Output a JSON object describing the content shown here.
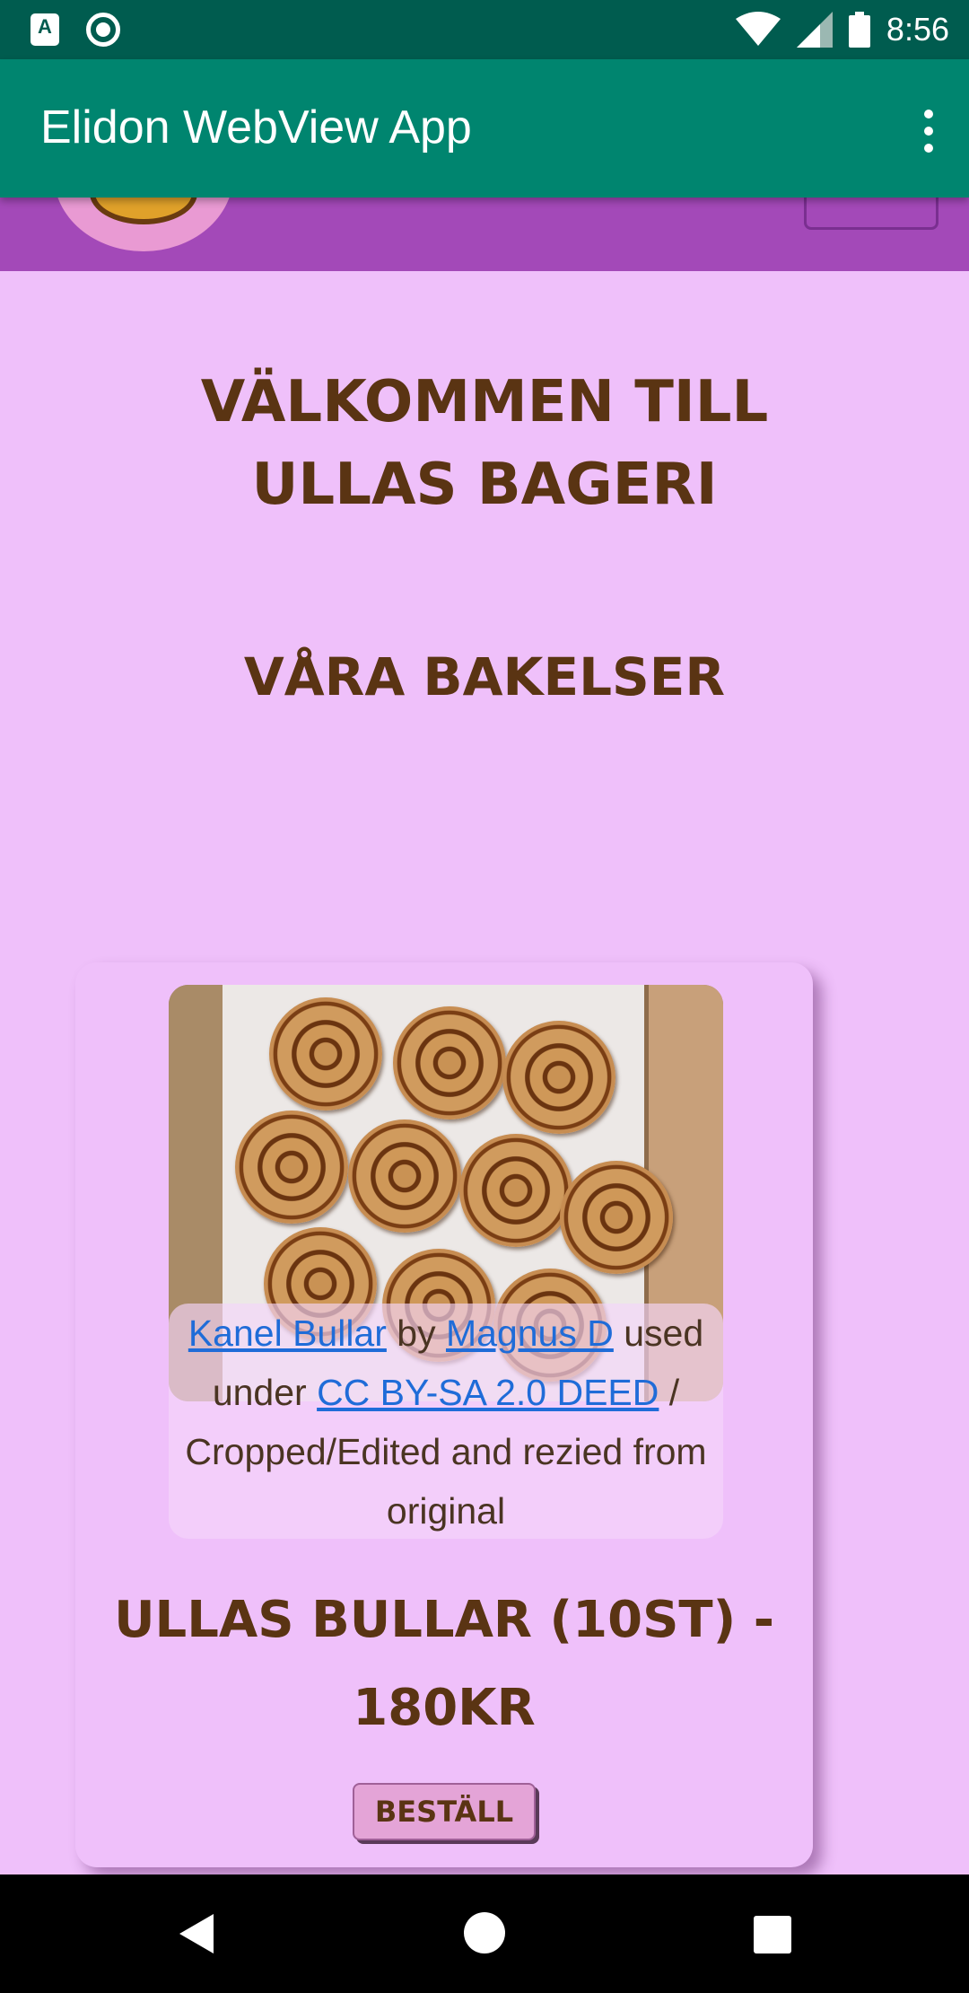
{
  "status_bar": {
    "time": "8:56",
    "icons": [
      "app-notification-icon",
      "circle-notification-icon",
      "wifi-icon",
      "cell-signal-icon",
      "battery-icon"
    ]
  },
  "app_bar": {
    "title": "Elidon WebView App",
    "menu_icon": "overflow-menu-icon"
  },
  "page": {
    "welcome_heading": "Välkommen till Ullas Bageri",
    "section_heading": "Våra bakelser"
  },
  "product": {
    "caption": {
      "link1": "Kanel Bullar",
      "by": " by ",
      "link2": "Magnus D",
      "used_under": " used under ",
      "link3": "CC BY-SA 2.0 DEED",
      "rest": " / Cropped/Edited and rezied from original"
    },
    "title": "Ullas Bullar (10st) - 180kr",
    "order_button": "Beställ"
  },
  "nav_bar": {
    "icons": [
      "back-icon",
      "home-icon",
      "recents-icon"
    ]
  },
  "colors": {
    "status_bar": "#005c4f",
    "app_bar": "#00856f",
    "site_header": "#a349b8",
    "page_background": "#efc0fa",
    "heading_text": "#5a3413",
    "link": "#1f6cd8",
    "order_button": "#e4a4d7"
  }
}
